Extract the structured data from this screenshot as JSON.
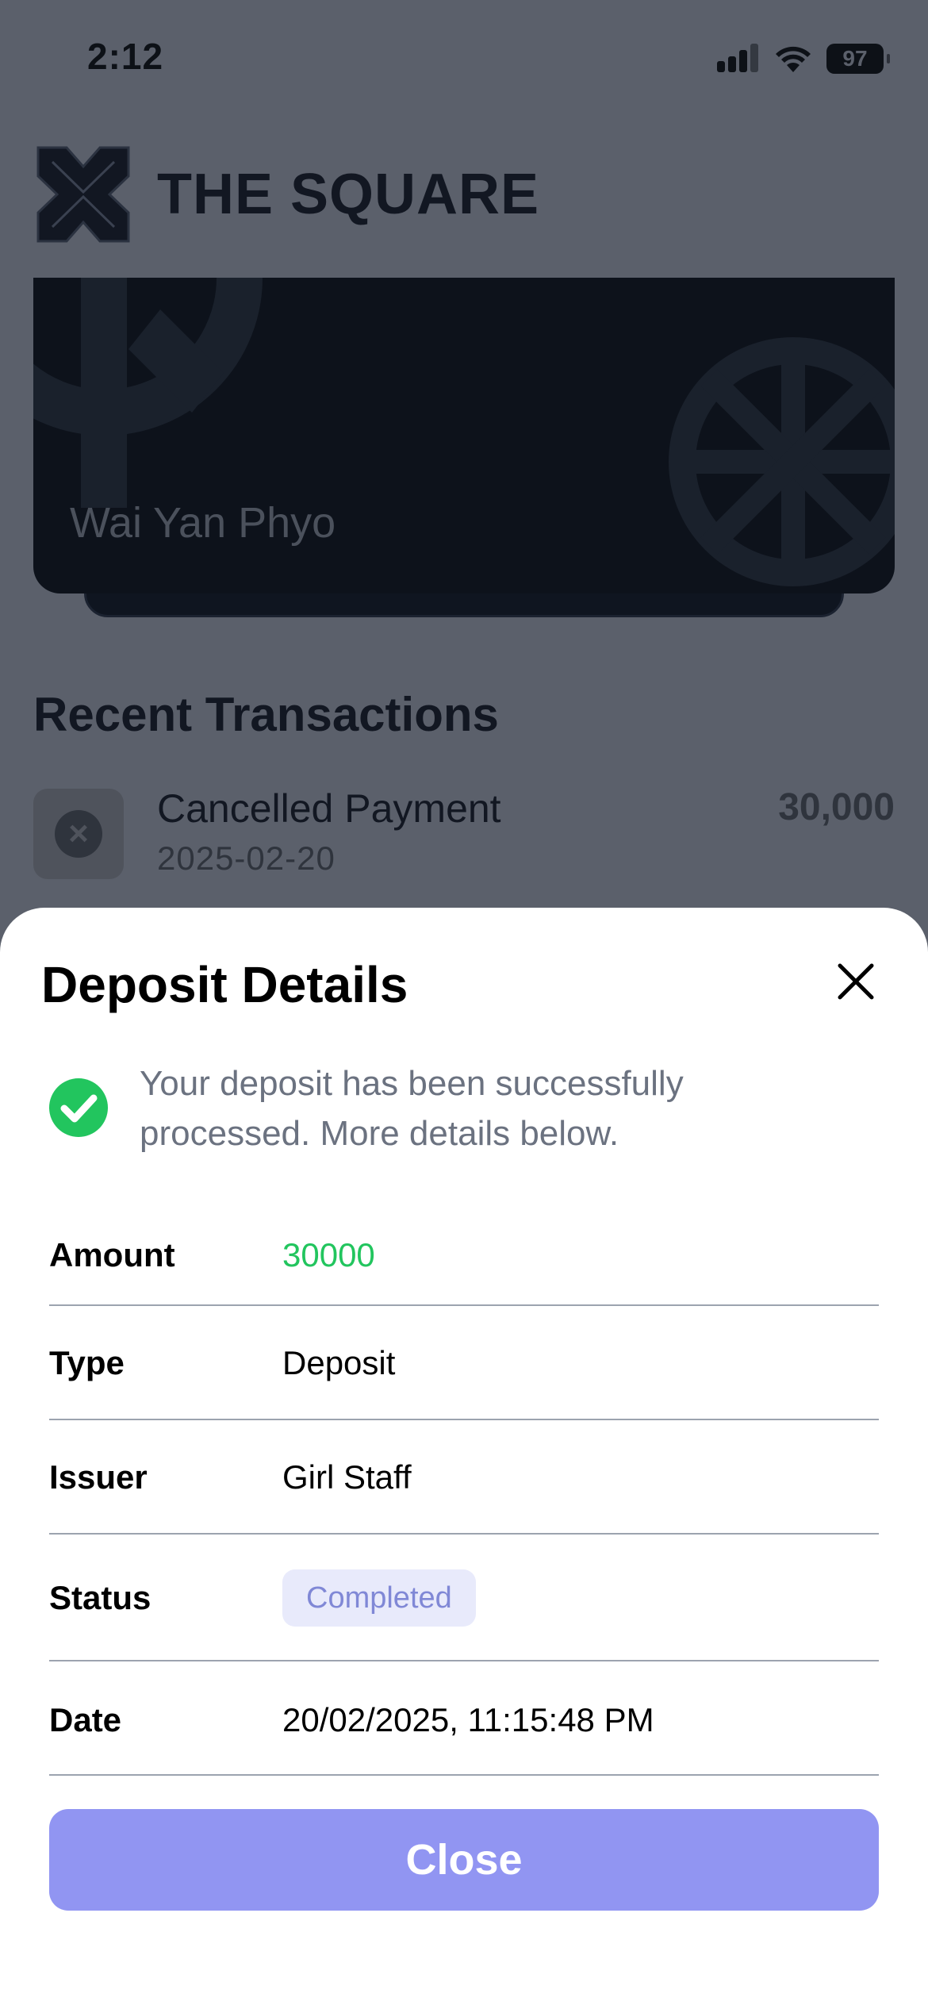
{
  "status_bar": {
    "time": "2:12",
    "battery": "97"
  },
  "brand": {
    "name": "THE SQUARE"
  },
  "card": {
    "holder_name": "Wai Yan Phyo"
  },
  "recent": {
    "title": "Recent Transactions",
    "transaction": {
      "title": "Cancelled Payment",
      "date": "2025-02-20",
      "amount": "30,000"
    }
  },
  "sheet": {
    "title": "Deposit Details",
    "message": "Your deposit has been successfully processed. More details below.",
    "rows": [
      {
        "label": "Amount",
        "value": "30000"
      },
      {
        "label": "Type",
        "value": "Deposit"
      },
      {
        "label": "Issuer",
        "value": "Girl Staff"
      },
      {
        "label": "Status",
        "value": "Completed"
      },
      {
        "label": "Date",
        "value": "20/02/2025, 11:15:48 PM"
      }
    ],
    "close_label": "Close"
  },
  "colors": {
    "success": "#22c55e",
    "button": "#9195f2",
    "badge_bg": "#e8eafb",
    "badge_text": "#8088d6"
  },
  "icons": [
    "signal-icon",
    "wifi-icon",
    "battery-icon",
    "brand-logo-icon",
    "cancel-icon",
    "close-icon",
    "check-circle-icon"
  ]
}
